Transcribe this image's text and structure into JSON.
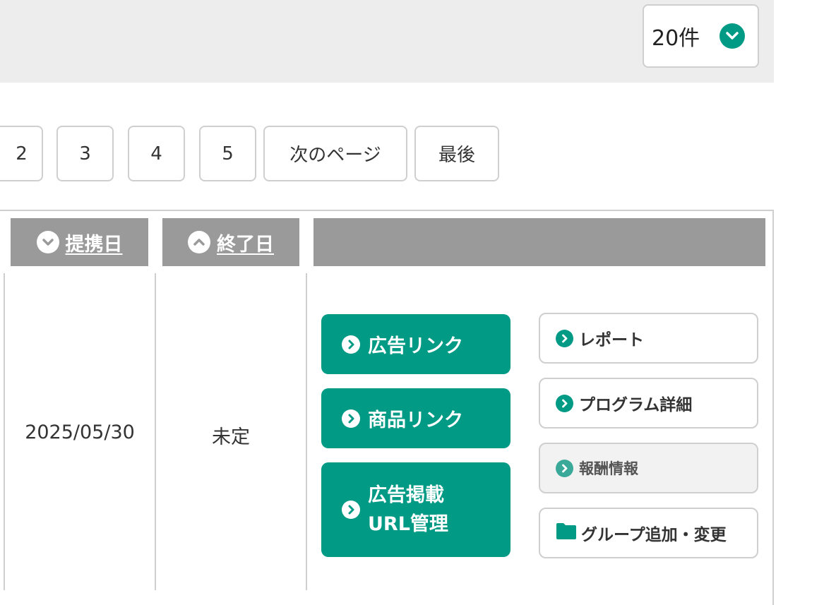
{
  "colors": {
    "accent": "#009a85",
    "header_gray": "#9a9a9a",
    "border": "#cfcfcf",
    "topbar": "#ededed"
  },
  "per_page": {
    "label": "20件",
    "icon": "chevron-down-icon"
  },
  "pagination": {
    "pages": [
      "2",
      "3",
      "4",
      "5"
    ],
    "next_label": "次のページ",
    "last_label": "最後"
  },
  "table": {
    "headers": {
      "partner_date": {
        "label": "提携日",
        "sort_icon": "chevron-down-icon"
      },
      "end_date": {
        "label": "終了日",
        "sort_icon": "chevron-up-icon"
      },
      "actions": {
        "label": ""
      }
    },
    "row": {
      "partner_date": "2025/05/30",
      "end_date": "未定"
    }
  },
  "actions": {
    "ad_link": "広告リンク",
    "product_link": "商品リンク",
    "ad_url_line1": "広告掲載",
    "ad_url_line2": "URL管理",
    "report": "レポート",
    "program_detail": "プログラム詳細",
    "reward_info": "報酬情報",
    "group_change": "グループ追加・変更"
  }
}
